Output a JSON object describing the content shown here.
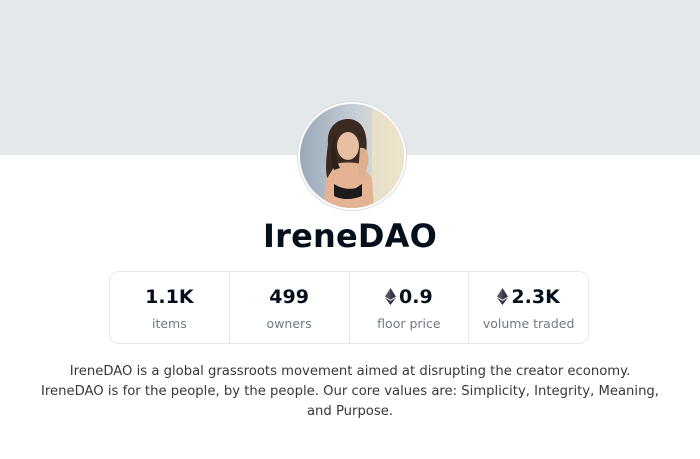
{
  "collection": {
    "name": "IreneDAO",
    "description_lines": [
      "IreneDAO is a global grassroots movement aimed at disrupting the creator economy.",
      "IreneDAO is for the people, by the people. Our core values are: Simplicity, Integrity, Meaning,",
      "and Purpose."
    ]
  },
  "stats": [
    {
      "value": "1.1K",
      "label": "items",
      "icon": null
    },
    {
      "value": "499",
      "label": "owners",
      "icon": null
    },
    {
      "value": "0.9",
      "label": "floor price",
      "icon": "ethereum-icon"
    },
    {
      "value": "2.3K",
      "label": "volume traded",
      "icon": "ethereum-icon"
    }
  ],
  "colors": {
    "banner": "#e5e8eb",
    "title": "#04111d",
    "label": "#707a83",
    "border": "#e5e8eb"
  }
}
